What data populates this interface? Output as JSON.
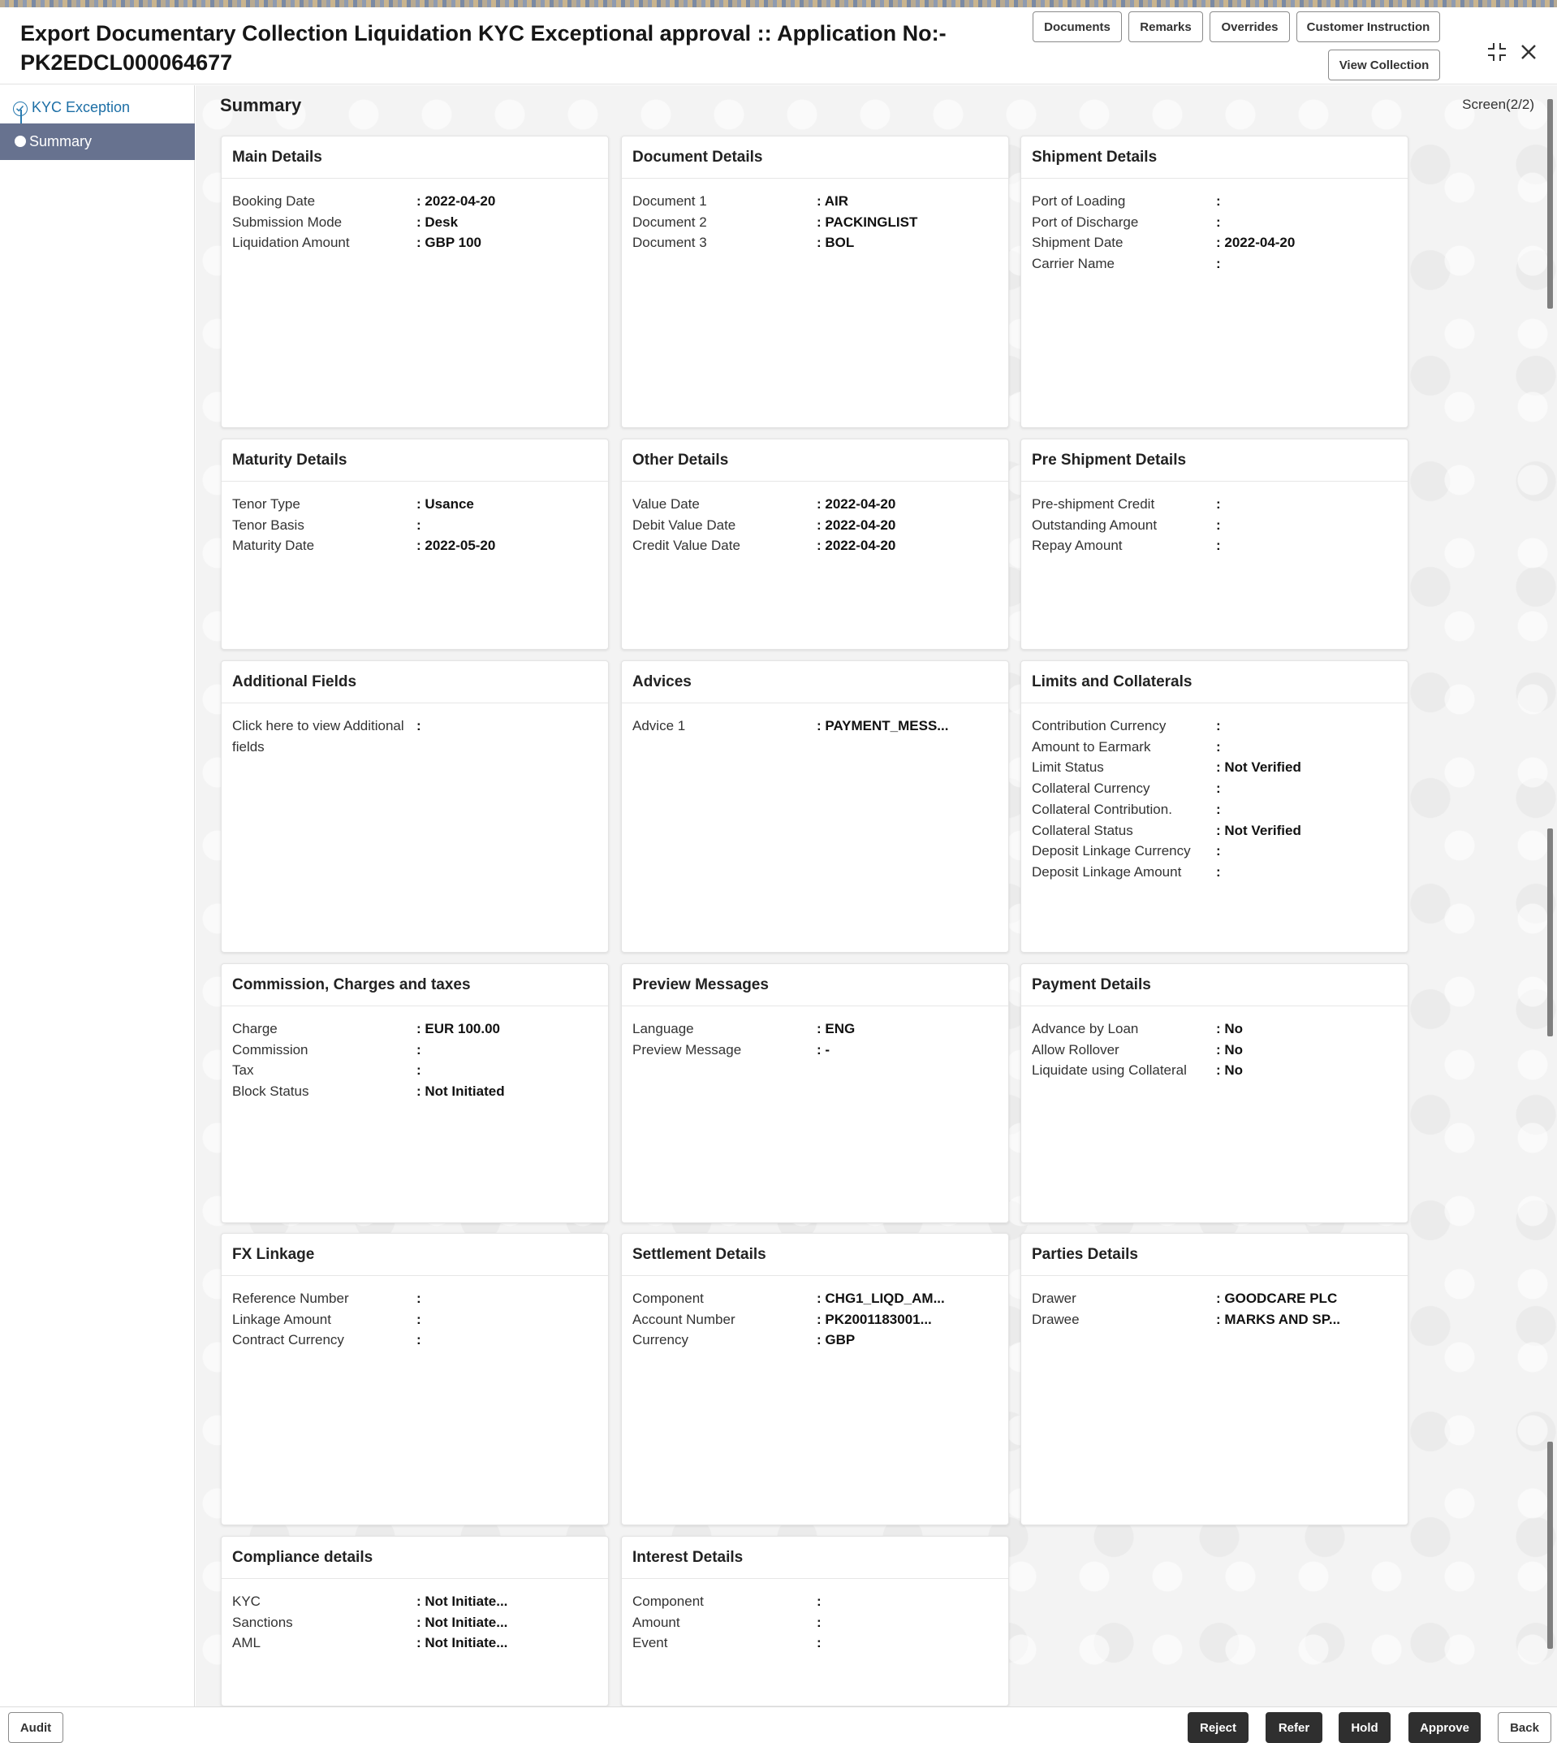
{
  "header": {
    "title_line1": "Export Documentary Collection Liquidation KYC Exceptional approval :: Application No:-",
    "title_line2": "PK2EDCL000064677",
    "buttons": {
      "documents": "Documents",
      "remarks": "Remarks",
      "overrides": "Overrides",
      "customer_instruction": "Customer Instruction",
      "view_collection": "View Collection"
    },
    "icons": {
      "minimize": "minimize-icon",
      "close": "close-icon"
    }
  },
  "sidebar": {
    "steps": [
      {
        "label": "KYC Exception",
        "state": "completed"
      },
      {
        "label": "Summary",
        "state": "active"
      }
    ]
  },
  "main": {
    "title": "Summary",
    "screen_indicator": "Screen(2/2)"
  },
  "cards": {
    "main_details": {
      "title": "Main Details",
      "rows": [
        {
          "k": "Booking Date",
          "v": ": 2022-04-20"
        },
        {
          "k": "Submission Mode",
          "v": ": Desk"
        },
        {
          "k": "Liquidation Amount",
          "v": ": GBP 100"
        }
      ]
    },
    "document_details": {
      "title": "Document Details",
      "rows": [
        {
          "k": "Document 1",
          "v": ": AIR"
        },
        {
          "k": "Document 2",
          "v": ": PACKINGLIST"
        },
        {
          "k": "Document 3",
          "v": ": BOL"
        }
      ]
    },
    "shipment_details": {
      "title": "Shipment Details",
      "rows": [
        {
          "k": "Port of Loading",
          "v": ":"
        },
        {
          "k": "Port of Discharge",
          "v": ":"
        },
        {
          "k": "Shipment Date",
          "v": ": 2022-04-20"
        },
        {
          "k": "Carrier Name",
          "v": ":"
        }
      ]
    },
    "maturity_details": {
      "title": "Maturity Details",
      "rows": [
        {
          "k": "Tenor Type",
          "v": ": Usance"
        },
        {
          "k": "Tenor Basis",
          "v": ":"
        },
        {
          "k": "Maturity Date",
          "v": ": 2022-05-20"
        }
      ]
    },
    "other_details": {
      "title": "Other Details",
      "rows": [
        {
          "k": "Value Date",
          "v": ": 2022-04-20"
        },
        {
          "k": "Debit Value Date",
          "v": ": 2022-04-20"
        },
        {
          "k": "Credit Value Date",
          "v": ": 2022-04-20"
        }
      ]
    },
    "pre_shipment_details": {
      "title": "Pre Shipment Details",
      "rows": [
        {
          "k": "Pre-shipment Credit",
          "v": ":"
        },
        {
          "k": "Outstanding Amount",
          "v": ":"
        },
        {
          "k": "Repay Amount",
          "v": ":"
        }
      ]
    },
    "additional_fields": {
      "title": "Additional Fields",
      "rows": [
        {
          "k": "Click here to view Additional fields",
          "v": ":"
        }
      ]
    },
    "advices": {
      "title": "Advices",
      "rows": [
        {
          "k": "Advice 1",
          "v": ": PAYMENT_MESS..."
        }
      ]
    },
    "limits_and_collaterals": {
      "title": "Limits and Collaterals",
      "rows": [
        {
          "k": "Contribution Currency",
          "v": ":"
        },
        {
          "k": "Amount to Earmark",
          "v": ":"
        },
        {
          "k": "Limit Status",
          "v": ": Not Verified"
        },
        {
          "k": "Collateral Currency",
          "v": ":"
        },
        {
          "k": "Collateral Contribution.",
          "v": ":"
        },
        {
          "k": "Collateral Status",
          "v": ": Not Verified"
        },
        {
          "k": "Deposit Linkage Currency",
          "v": ":"
        },
        {
          "k": "Deposit Linkage Amount",
          "v": ":"
        }
      ]
    },
    "commission_charges_taxes": {
      "title": "Commission, Charges and taxes",
      "rows": [
        {
          "k": "Charge",
          "v": ": EUR  100.00"
        },
        {
          "k": "Commission",
          "v": ":"
        },
        {
          "k": "Tax",
          "v": ":"
        },
        {
          "k": "Block Status",
          "v": ": Not Initiated"
        }
      ]
    },
    "preview_messages": {
      "title": "Preview Messages",
      "rows": [
        {
          "k": "Language",
          "v": ": ENG"
        },
        {
          "k": "Preview Message",
          "v": ": -"
        }
      ]
    },
    "payment_details": {
      "title": "Payment Details",
      "rows": [
        {
          "k": "Advance by Loan",
          "v": ": No"
        },
        {
          "k": "Allow Rollover",
          "v": ": No"
        },
        {
          "k": "Liquidate using Collateral",
          "v": ": No"
        }
      ]
    },
    "fx_linkage": {
      "title": "FX Linkage",
      "rows": [
        {
          "k": "Reference Number",
          "v": ":"
        },
        {
          "k": "Linkage Amount",
          "v": ":"
        },
        {
          "k": "Contract Currency",
          "v": ":"
        }
      ]
    },
    "settlement_details": {
      "title": "Settlement Details",
      "rows": [
        {
          "k": "Component",
          "v": ": CHG1_LIQD_AM..."
        },
        {
          "k": "Account Number",
          "v": ": PK2001183001..."
        },
        {
          "k": "Currency",
          "v": ": GBP"
        }
      ]
    },
    "parties_details": {
      "title": "Parties Details",
      "rows": [
        {
          "k": "Drawer",
          "v": ": GOODCARE PLC"
        },
        {
          "k": "Drawee",
          "v": ": MARKS AND SP..."
        }
      ]
    },
    "compliance_details": {
      "title": "Compliance details",
      "rows": [
        {
          "k": "KYC",
          "v": ": Not Initiate..."
        },
        {
          "k": "Sanctions",
          "v": ": Not Initiate..."
        },
        {
          "k": "AML",
          "v": ": Not Initiate..."
        }
      ]
    },
    "interest_details": {
      "title": "Interest Details",
      "rows": [
        {
          "k": "Component",
          "v": ":"
        },
        {
          "k": "Amount",
          "v": ":"
        },
        {
          "k": "Event",
          "v": ":"
        }
      ]
    }
  },
  "footer": {
    "audit": "Audit",
    "reject": "Reject",
    "refer": "Refer",
    "hold": "Hold",
    "approve": "Approve",
    "back": "Back"
  }
}
